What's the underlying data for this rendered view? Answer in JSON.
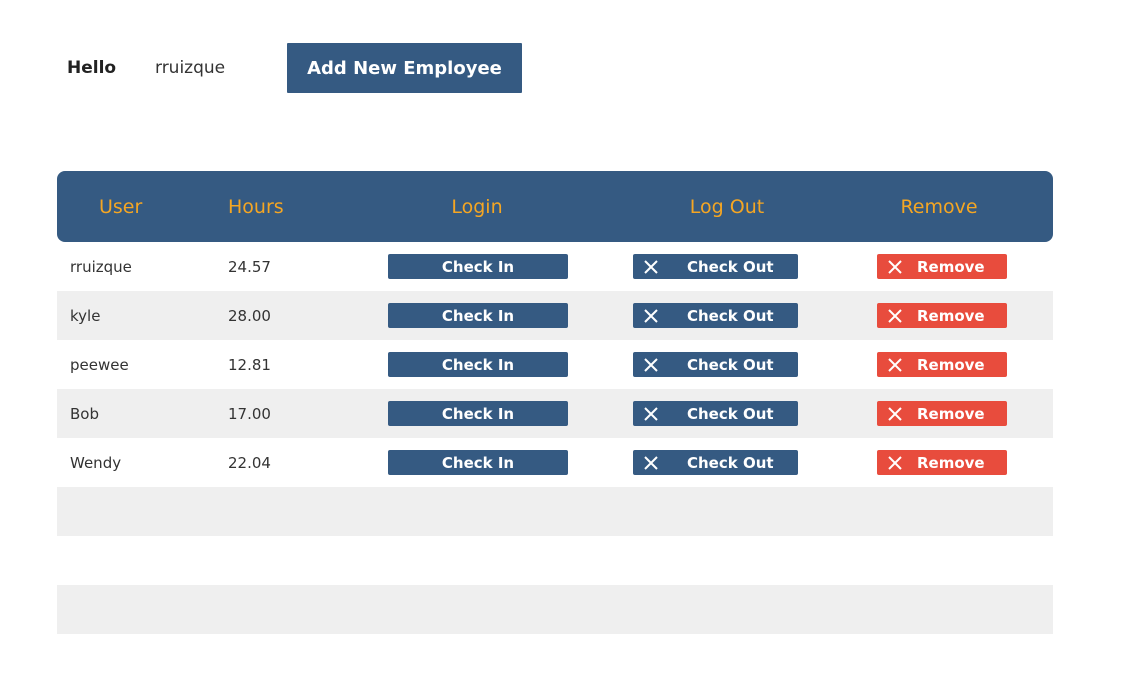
{
  "header": {
    "hello_label": "Hello",
    "username": "rruizque",
    "add_button_label": "Add New Employee"
  },
  "table": {
    "columns": [
      "User",
      "Hours",
      "Login",
      "Log Out",
      "Remove"
    ],
    "rows": [
      {
        "user": "rruizque",
        "hours": "24.57"
      },
      {
        "user": "kyle",
        "hours": "28.00"
      },
      {
        "user": "peewee",
        "hours": "12.81"
      },
      {
        "user": "Bob",
        "hours": "17.00"
      },
      {
        "user": "Wendy",
        "hours": "22.04"
      }
    ],
    "check_in_label": "Check In",
    "check_out_label": "Check Out",
    "remove_label": "Remove"
  },
  "colors": {
    "primary": "#355a82",
    "accent": "#f5a623",
    "danger": "#e84c3d",
    "stripe": "#efefef"
  },
  "icons": {
    "checkout": "close-icon",
    "remove": "close-icon"
  }
}
